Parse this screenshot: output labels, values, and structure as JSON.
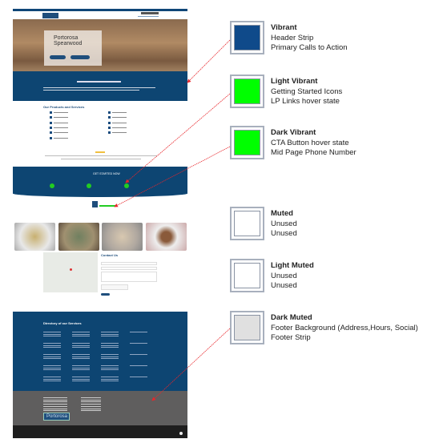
{
  "website": {
    "hero_title": "Portorosa Spearwood",
    "products_title": "Our Products and Services",
    "get_started": "GET STARTED NOW",
    "contact_title": "Contact Us",
    "directory_title": "Directory of our Services",
    "footer_logo": "Portorosa",
    "colors": {
      "header": "#0f4678",
      "band": "#0d4572",
      "footer": "#5f5e5e",
      "strip": "#1e1e1e",
      "icon_green": "#22cc22"
    }
  },
  "swatches": [
    {
      "name": "Vibrant",
      "usage": [
        "Header Strip",
        "Primary Calls to Action"
      ],
      "color": "#0f4a8a"
    },
    {
      "name": "Light Vibrant",
      "usage": [
        "Getting Started Icons",
        "LP Links hover state"
      ],
      "color": "#00ff00"
    },
    {
      "name": "Dark Vibrant",
      "usage": [
        "CTA Button hover state",
        "Mid Page Phone Number"
      ],
      "color": "#00ff00"
    },
    {
      "name": "Muted",
      "usage": [
        "Unused",
        "Unused"
      ],
      "color": "#ffffff"
    },
    {
      "name": "Light Muted",
      "usage": [
        "Unused",
        "Unused"
      ],
      "color": "#ffffff"
    },
    {
      "name": "Dark Muted",
      "usage": [
        "Footer Background (Address,Hours, Social)",
        "Footer Strip"
      ],
      "color": "#e0e0e0"
    }
  ],
  "arrow_color": "#e8262b"
}
